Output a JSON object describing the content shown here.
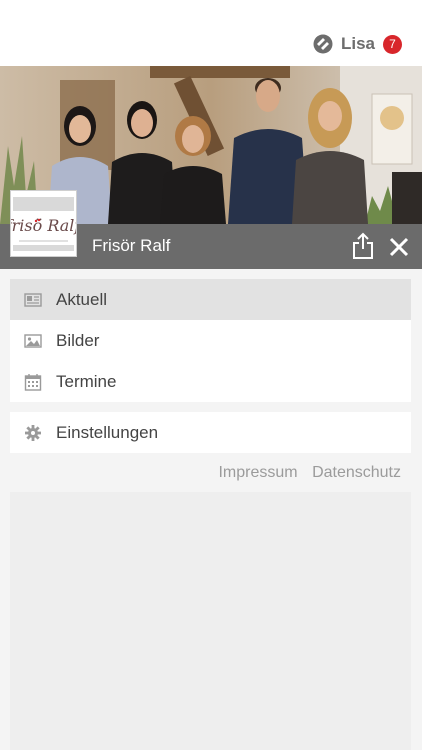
{
  "user": {
    "name": "Lisa",
    "badge_count": "7"
  },
  "salon": {
    "name": "Frisör Ralf",
    "logo_text": "frisö Ralf"
  },
  "menu_main": [
    {
      "label": "Aktuell",
      "icon": "news-icon",
      "active": true
    },
    {
      "label": "Bilder",
      "icon": "image-icon",
      "active": false
    },
    {
      "label": "Termine",
      "icon": "calendar-icon",
      "active": false
    }
  ],
  "menu_settings": {
    "label": "Einstellungen",
    "icon": "gear-icon"
  },
  "footer": {
    "impressum": "Impressum",
    "datenschutz": "Datenschutz"
  },
  "colors": {
    "badge": "#d8262b",
    "salon_bar": "#6b6b6b",
    "active_item": "#e2e2e2"
  }
}
